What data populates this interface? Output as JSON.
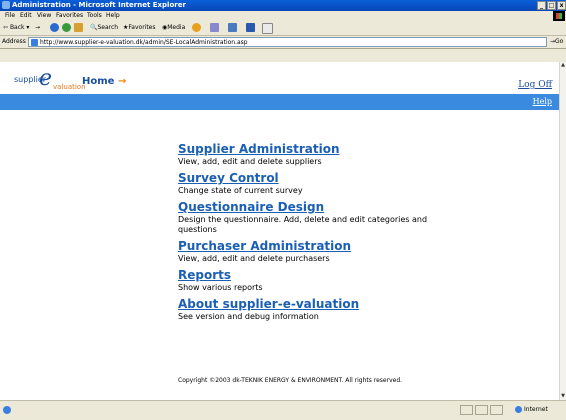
{
  "window": {
    "title": "Administration - Microsoft Internet Explorer",
    "buttons": {
      "minimize": "_",
      "maximize": "□",
      "close": "x"
    }
  },
  "menubar": [
    "File",
    "Edit",
    "View",
    "Favorites",
    "Tools",
    "Help"
  ],
  "toolbar": {
    "back": "Back",
    "forward": "→",
    "search": "Search",
    "favorites": "Favorites",
    "media": "Media"
  },
  "address": {
    "label": "Address",
    "url": "http://www.supplier-e-valuation.dk/admin/SE-LocalAdministration.asp",
    "go": "Go"
  },
  "header": {
    "logo_supplier": "supplier",
    "logo_e": "e",
    "logo_valuation": "valuation",
    "home": "Home",
    "home_arrow": "→",
    "logoff": "Log Off",
    "help": "Help"
  },
  "menu_items": [
    {
      "title": "Supplier Administration",
      "desc": "View, add, edit and delete suppliers"
    },
    {
      "title": "Survey Control",
      "desc": "Change state of current survey"
    },
    {
      "title": "Questionnaire Design",
      "desc": "Design the questionnaire. Add, delete and edit categories and questions"
    },
    {
      "title": "Purchaser Administration",
      "desc": "View, add, edit and delete purchasers"
    },
    {
      "title": "Reports",
      "desc": "Show various reports"
    },
    {
      "title": "About supplier-e-valuation",
      "desc": "See version and debug information"
    }
  ],
  "copyright": "Copyright ©2003 dk-TEKNIK ENERGY & ENVIRONMENT. All rights reserved.",
  "status": {
    "zone": "Internet"
  },
  "colors": {
    "brand_blue": "#1a4fa0",
    "bar_blue": "#3a8be0",
    "accent_orange": "#e8781a"
  }
}
